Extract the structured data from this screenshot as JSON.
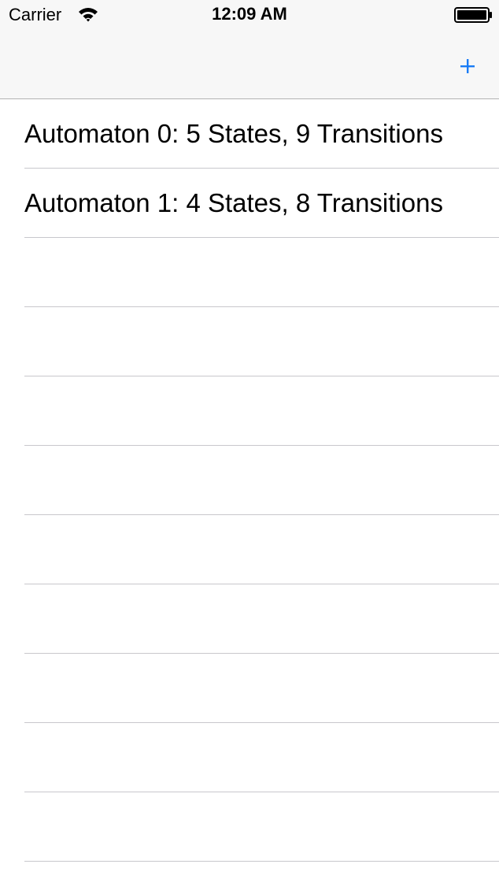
{
  "status_bar": {
    "carrier": "Carrier",
    "time": "12:09 AM",
    "wifi_icon": "wifi-icon",
    "battery_icon": "battery-icon"
  },
  "nav_bar": {
    "add_icon": "plus-icon",
    "accent_color": "#1a7cf6"
  },
  "automata": [
    {
      "label": "Automaton 0: 5 States, 9 Transitions"
    },
    {
      "label": "Automaton 1: 4 States, 8 Transitions"
    },
    {
      "label": ""
    },
    {
      "label": ""
    },
    {
      "label": ""
    },
    {
      "label": ""
    },
    {
      "label": ""
    },
    {
      "label": ""
    },
    {
      "label": ""
    },
    {
      "label": ""
    },
    {
      "label": ""
    }
  ]
}
